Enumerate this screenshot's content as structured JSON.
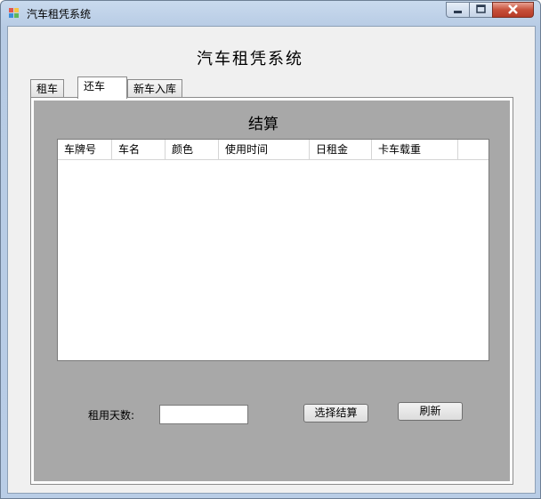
{
  "window": {
    "title": "汽车租凭系统"
  },
  "app": {
    "heading": "汽车租凭系统"
  },
  "tabs": [
    {
      "label": "租车"
    },
    {
      "label": "还车"
    },
    {
      "label": "新车入库"
    }
  ],
  "active_tab": "还车",
  "return_page": {
    "title": "结算",
    "columns": [
      "车牌号",
      "车名",
      "颜色",
      "使用时间",
      "日租金",
      "卡车载重"
    ],
    "rows": [],
    "days_label": "租用天数:",
    "days_value": "",
    "settle_button": "选择结算",
    "refresh_button": "刷新"
  }
}
